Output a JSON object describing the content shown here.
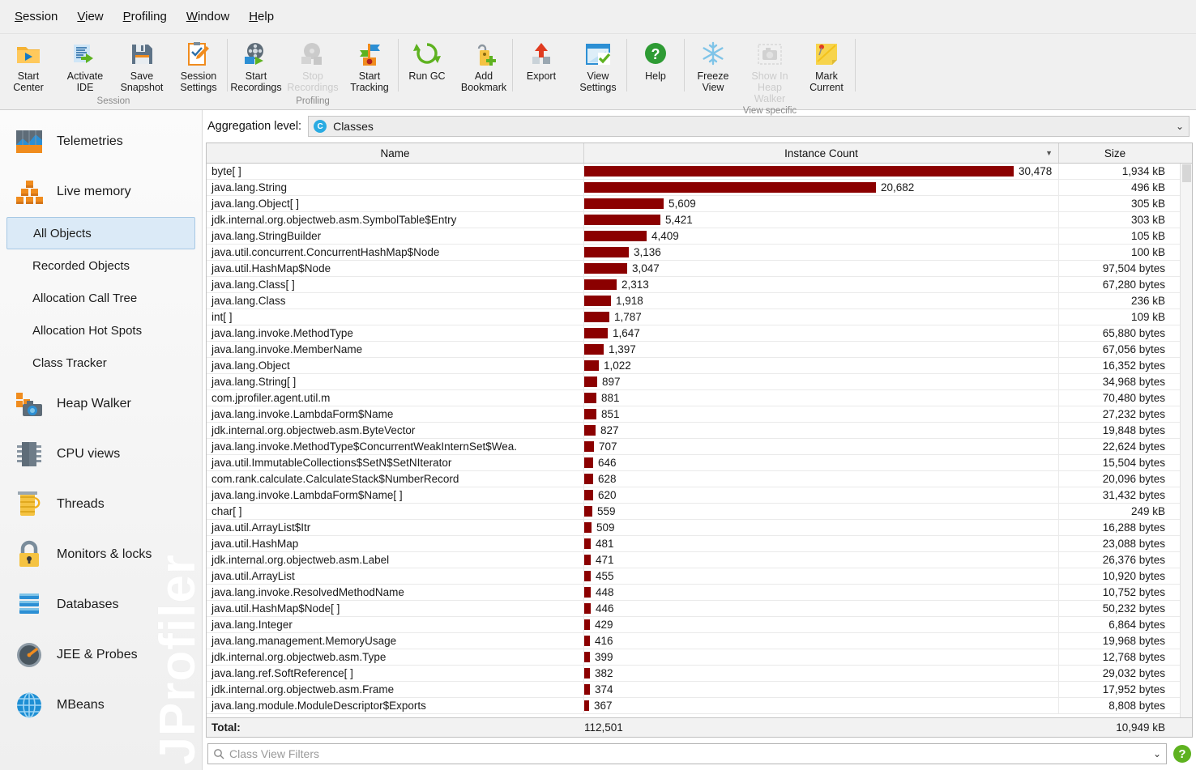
{
  "menu": [
    "Session",
    "View",
    "Profiling",
    "Window",
    "Help"
  ],
  "toolbar": {
    "groups": [
      {
        "caption": "Session",
        "buttons": [
          {
            "label": "Start\nCenter",
            "icon": "start-center-icon",
            "disabled": false
          },
          {
            "label": "Activate\nIDE",
            "icon": "activate-ide-icon",
            "disabled": false
          },
          {
            "label": "Save\nSnapshot",
            "icon": "save-snapshot-icon",
            "disabled": false
          },
          {
            "label": "Session\nSettings",
            "icon": "session-settings-icon",
            "disabled": false
          }
        ]
      },
      {
        "caption": "Profiling",
        "buttons": [
          {
            "label": "Start\nRecordings",
            "icon": "start-recordings-icon",
            "disabled": false
          },
          {
            "label": "Stop\nRecordings",
            "icon": "stop-recordings-icon",
            "disabled": true
          },
          {
            "label": "Start\nTracking",
            "icon": "start-tracking-icon",
            "disabled": false
          }
        ]
      },
      {
        "caption": "",
        "buttons": [
          {
            "label": "Run GC",
            "icon": "run-gc-icon",
            "disabled": false
          },
          {
            "label": "Add\nBookmark",
            "icon": "add-bookmark-icon",
            "disabled": false
          }
        ]
      },
      {
        "caption": "",
        "buttons": [
          {
            "label": "Export",
            "icon": "export-icon",
            "disabled": false
          },
          {
            "label": "View\nSettings",
            "icon": "view-settings-icon",
            "disabled": false
          }
        ]
      },
      {
        "caption": "",
        "buttons": [
          {
            "label": "Help",
            "icon": "help-icon",
            "disabled": false
          }
        ]
      },
      {
        "caption": "View specific",
        "buttons": [
          {
            "label": "Freeze\nView",
            "icon": "freeze-view-icon",
            "disabled": false
          },
          {
            "label": "Show In\nHeap Walker",
            "icon": "show-in-heap-walker-icon",
            "disabled": true
          },
          {
            "label": "Mark\nCurrent",
            "icon": "mark-current-icon",
            "disabled": false
          }
        ]
      }
    ]
  },
  "sidebar": {
    "watermark": "JProfiler",
    "items": [
      {
        "label": "Telemetries",
        "type": "top",
        "icon": "telemetries-icon",
        "selected": false
      },
      {
        "label": "Live memory",
        "type": "top",
        "icon": "live-memory-icon",
        "selected": false
      },
      {
        "label": "All Objects",
        "type": "sub",
        "selected": true
      },
      {
        "label": "Recorded Objects",
        "type": "sub",
        "selected": false
      },
      {
        "label": "Allocation Call Tree",
        "type": "sub",
        "selected": false
      },
      {
        "label": "Allocation Hot Spots",
        "type": "sub",
        "selected": false
      },
      {
        "label": "Class Tracker",
        "type": "sub",
        "selected": false
      },
      {
        "label": "Heap Walker",
        "type": "top",
        "icon": "heap-walker-icon",
        "selected": false
      },
      {
        "label": "CPU views",
        "type": "top",
        "icon": "cpu-views-icon",
        "selected": false
      },
      {
        "label": "Threads",
        "type": "top",
        "icon": "threads-icon",
        "selected": false
      },
      {
        "label": "Monitors & locks",
        "type": "top",
        "icon": "monitors-locks-icon",
        "selected": false
      },
      {
        "label": "Databases",
        "type": "top",
        "icon": "databases-icon",
        "selected": false
      },
      {
        "label": "JEE & Probes",
        "type": "top",
        "icon": "jee-probes-icon",
        "selected": false
      },
      {
        "label": "MBeans",
        "type": "top",
        "icon": "mbeans-icon",
        "selected": false
      }
    ]
  },
  "aggregation": {
    "label": "Aggregation level:",
    "value": "Classes",
    "icon": "class-icon",
    "caret": "chevron-down-icon"
  },
  "table": {
    "columns": [
      "Name",
      "Instance Count",
      "Size"
    ],
    "sorted_column": "Instance Count",
    "sort_direction": "descending",
    "bar_color": "#8B0000",
    "max_count": 30478,
    "rows": [
      {
        "name": "byte[ ]",
        "count": 30478,
        "count_label": "30,478",
        "size": "1,934 kB"
      },
      {
        "name": "java.lang.String",
        "count": 20682,
        "count_label": "20,682",
        "size": "496 kB"
      },
      {
        "name": "java.lang.Object[ ]",
        "count": 5609,
        "count_label": "5,609",
        "size": "305 kB"
      },
      {
        "name": "jdk.internal.org.objectweb.asm.SymbolTable$Entry",
        "count": 5421,
        "count_label": "5,421",
        "size": "303 kB"
      },
      {
        "name": "java.lang.StringBuilder",
        "count": 4409,
        "count_label": "4,409",
        "size": "105 kB"
      },
      {
        "name": "java.util.concurrent.ConcurrentHashMap$Node",
        "count": 3136,
        "count_label": "3,136",
        "size": "100 kB"
      },
      {
        "name": "java.util.HashMap$Node",
        "count": 3047,
        "count_label": "3,047",
        "size": "97,504 bytes"
      },
      {
        "name": "java.lang.Class[ ]",
        "count": 2313,
        "count_label": "2,313",
        "size": "67,280 bytes"
      },
      {
        "name": "java.lang.Class",
        "count": 1918,
        "count_label": "1,918",
        "size": "236 kB"
      },
      {
        "name": "int[ ]",
        "count": 1787,
        "count_label": "1,787",
        "size": "109 kB"
      },
      {
        "name": "java.lang.invoke.MethodType",
        "count": 1647,
        "count_label": "1,647",
        "size": "65,880 bytes"
      },
      {
        "name": "java.lang.invoke.MemberName",
        "count": 1397,
        "count_label": "1,397",
        "size": "67,056 bytes"
      },
      {
        "name": "java.lang.Object",
        "count": 1022,
        "count_label": "1,022",
        "size": "16,352 bytes"
      },
      {
        "name": "java.lang.String[ ]",
        "count": 897,
        "count_label": "897",
        "size": "34,968 bytes"
      },
      {
        "name": "com.jprofiler.agent.util.m",
        "count": 881,
        "count_label": "881",
        "size": "70,480 bytes"
      },
      {
        "name": "java.lang.invoke.LambdaForm$Name",
        "count": 851,
        "count_label": "851",
        "size": "27,232 bytes"
      },
      {
        "name": "jdk.internal.org.objectweb.asm.ByteVector",
        "count": 827,
        "count_label": "827",
        "size": "19,848 bytes"
      },
      {
        "name": "java.lang.invoke.MethodType$ConcurrentWeakInternSet$Wea.",
        "count": 707,
        "count_label": "707",
        "size": "22,624 bytes"
      },
      {
        "name": "java.util.ImmutableCollections$SetN$SetNIterator",
        "count": 646,
        "count_label": "646",
        "size": "15,504 bytes"
      },
      {
        "name": "com.rank.calculate.CalculateStack$NumberRecord",
        "count": 628,
        "count_label": "628",
        "size": "20,096 bytes"
      },
      {
        "name": "java.lang.invoke.LambdaForm$Name[ ]",
        "count": 620,
        "count_label": "620",
        "size": "31,432 bytes"
      },
      {
        "name": "char[ ]",
        "count": 559,
        "count_label": "559",
        "size": "249 kB"
      },
      {
        "name": "java.util.ArrayList$Itr",
        "count": 509,
        "count_label": "509",
        "size": "16,288 bytes"
      },
      {
        "name": "java.util.HashMap",
        "count": 481,
        "count_label": "481",
        "size": "23,088 bytes"
      },
      {
        "name": "jdk.internal.org.objectweb.asm.Label",
        "count": 471,
        "count_label": "471",
        "size": "26,376 bytes"
      },
      {
        "name": "java.util.ArrayList",
        "count": 455,
        "count_label": "455",
        "size": "10,920 bytes"
      },
      {
        "name": "java.lang.invoke.ResolvedMethodName",
        "count": 448,
        "count_label": "448",
        "size": "10,752 bytes"
      },
      {
        "name": "java.util.HashMap$Node[ ]",
        "count": 446,
        "count_label": "446",
        "size": "50,232 bytes"
      },
      {
        "name": "java.lang.Integer",
        "count": 429,
        "count_label": "429",
        "size": "6,864 bytes"
      },
      {
        "name": "java.lang.management.MemoryUsage",
        "count": 416,
        "count_label": "416",
        "size": "19,968 bytes"
      },
      {
        "name": "jdk.internal.org.objectweb.asm.Type",
        "count": 399,
        "count_label": "399",
        "size": "12,768 bytes"
      },
      {
        "name": "java.lang.ref.SoftReference[ ]",
        "count": 382,
        "count_label": "382",
        "size": "29,032 bytes"
      },
      {
        "name": "jdk.internal.org.objectweb.asm.Frame",
        "count": 374,
        "count_label": "374",
        "size": "17,952 bytes"
      },
      {
        "name": "java.lang.module.ModuleDescriptor$Exports",
        "count": 367,
        "count_label": "367",
        "size": "8,808 bytes"
      }
    ],
    "total": {
      "label": "Total:",
      "count": "112,501",
      "size": "10,949 kB"
    }
  },
  "filter": {
    "placeholder": "Class View Filters",
    "search_icon": "search-icon",
    "caret": "chevron-down-icon",
    "help": "?"
  }
}
